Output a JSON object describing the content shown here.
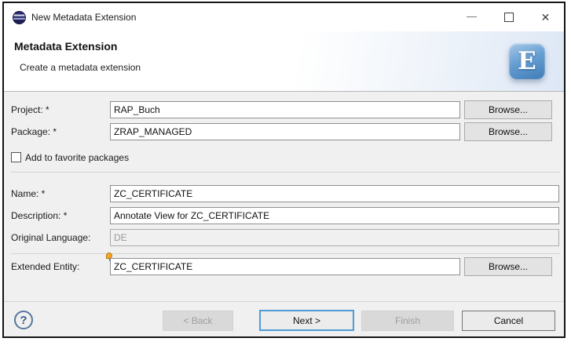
{
  "window": {
    "title": "New Metadata Extension",
    "icons": {
      "minimize": "—",
      "close": "✕"
    }
  },
  "banner": {
    "title": "Metadata Extension",
    "subtitle": "Create a metadata extension",
    "logo_letter": "E"
  },
  "form": {
    "project": {
      "label": "Project: *",
      "value": "RAP_Buch",
      "browse_label": "Browse..."
    },
    "package": {
      "label": "Package: *",
      "value": "ZRAP_MANAGED",
      "browse_label": "Browse..."
    },
    "favorite_checkbox": {
      "label": "Add to favorite packages",
      "checked": false
    },
    "name": {
      "label": "Name: *",
      "value": "ZC_CERTIFICATE"
    },
    "description": {
      "label": "Description: *",
      "value": "Annotate View for ZC_CERTIFICATE"
    },
    "original_language": {
      "label": "Original Language:",
      "value": "DE",
      "disabled": true
    },
    "extended_entity": {
      "label": "Extended Entity:",
      "value": "ZC_CERTIFICATE",
      "browse_label": "Browse..."
    }
  },
  "footer": {
    "help": "?",
    "back_label": "< Back",
    "next_label": "Next >",
    "finish_label": "Finish",
    "cancel_label": "Cancel"
  },
  "colors": {
    "body_background": "#f0f0f0",
    "default_button_border": "#4f9bd5",
    "banner_tint": "#dde7f5",
    "logo_blue": "#4a86c0",
    "eclipse_navy": "#2c2a66",
    "decorator_orange": "#f5a623"
  }
}
